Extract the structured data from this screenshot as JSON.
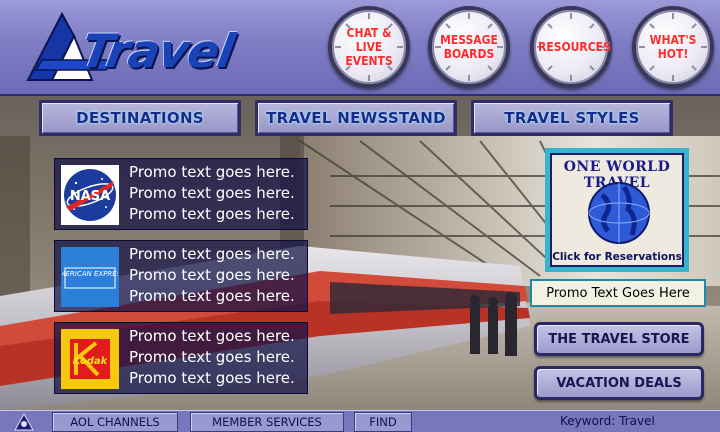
{
  "header": {
    "logo_text": "Travel",
    "clock_buttons": [
      {
        "label": "CHAT &\nLIVE\nEVENTS"
      },
      {
        "label": "MESSAGE\nBOARDS"
      },
      {
        "label": "RESOURCES"
      },
      {
        "label": "WHAT'S\nHOT!"
      }
    ]
  },
  "nav": {
    "destinations": "DESTINATIONS",
    "newsstand": "TRAVEL NEWSSTAND",
    "styles": "TRAVEL STYLES"
  },
  "promos": [
    {
      "sponsor_logo": "NASA",
      "lines": [
        "Promo text goes here.",
        "Promo text goes here.",
        "Promo text goes here."
      ]
    },
    {
      "sponsor_logo": "AMERICAN EXPRESS",
      "lines": [
        "Promo text goes here.",
        "Promo text goes here.",
        "Promo text goes here."
      ]
    },
    {
      "sponsor_logo": "Kodak",
      "lines": [
        "Promo text goes here.",
        "Promo text goes here.",
        "Promo text goes here."
      ]
    }
  ],
  "one_world": {
    "title": "ONE WORLD TRAVEL",
    "cta": "Click for Reservations"
  },
  "promo_box": "Promo Text Goes Here",
  "side_buttons": {
    "travel_store": "THE TRAVEL STORE",
    "vacation_deals": "VACATION DEALS"
  },
  "footer": {
    "aol_channels": "AOL CHANNELS",
    "member_services": "MEMBER SERVICES",
    "find": "FIND",
    "keyword": "Keyword: Travel"
  },
  "colors": {
    "header_bg": "#8886c8",
    "nav_text": "#182a8a",
    "clock_label": "#ff2a2a",
    "promo_bg": "#141246",
    "footer_bg": "#7876bc",
    "accent_cyan": "#38b4cc"
  },
  "icons": {
    "logo": "travel-arrow-logo",
    "footer": "aol-triangle-icon"
  }
}
